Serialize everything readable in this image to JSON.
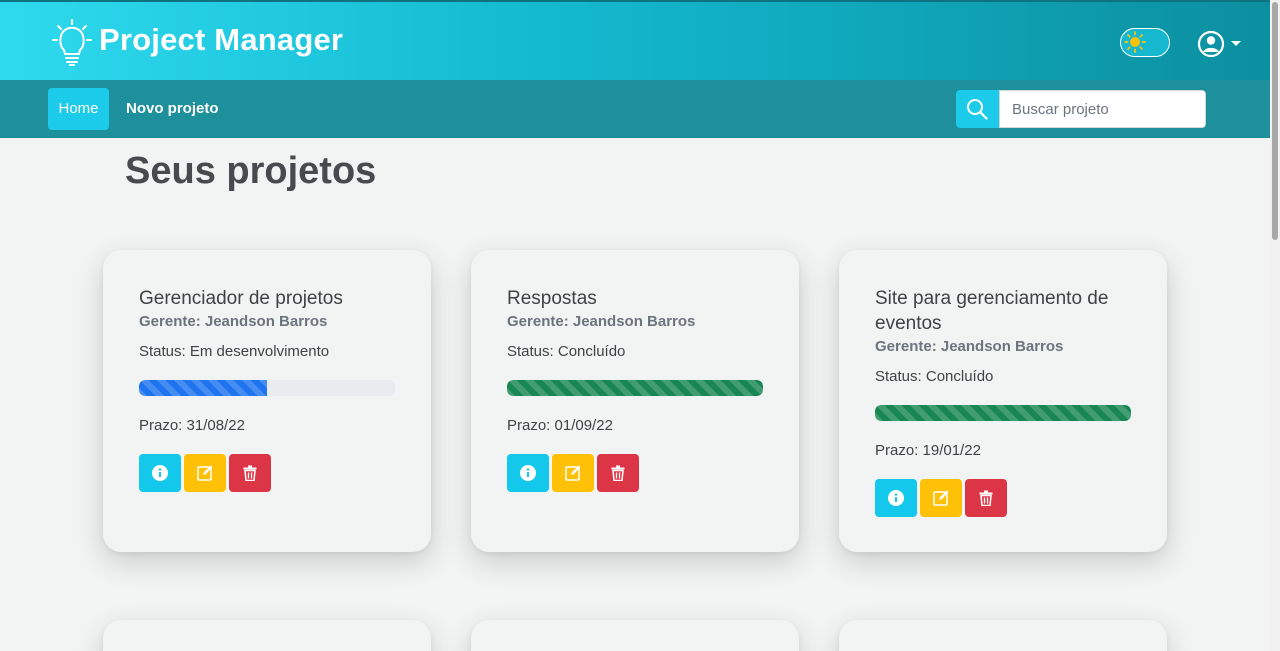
{
  "header": {
    "brand": "Project Manager",
    "logo_icon": "lightbulb-icon",
    "theme_toggle_icon": "sun-icon",
    "user_icon": "user-circle-icon"
  },
  "nav": {
    "home_label": "Home",
    "new_project_label": "Novo projeto",
    "search_placeholder": "Buscar projeto",
    "search_icon": "search-icon"
  },
  "main": {
    "title": "Seus projetos",
    "projects": [
      {
        "name": "Gerenciador de projetos",
        "manager": "Gerente: Jeandson Barros",
        "status": "Status: Em desenvolvimento",
        "progress_percent": 50,
        "deadline": "Prazo: 31/08/22"
      },
      {
        "name": "Respostas",
        "manager": "Gerente: Jeandson Barros",
        "status": "Status: Concluído",
        "progress_percent": 100,
        "deadline": "Prazo: 01/09/22"
      },
      {
        "name": "Site para gerenciamento de eventos",
        "manager": "Gerente: Jeandson Barros",
        "status": "Status: Concluído",
        "progress_percent": 100,
        "deadline": "Prazo: 19/01/22"
      }
    ]
  },
  "colors": {
    "info": "#14c8ec",
    "edit": "#fec107",
    "delete": "#dc3545",
    "progress_dev": "#1e74ee",
    "progress_done": "#198754"
  }
}
